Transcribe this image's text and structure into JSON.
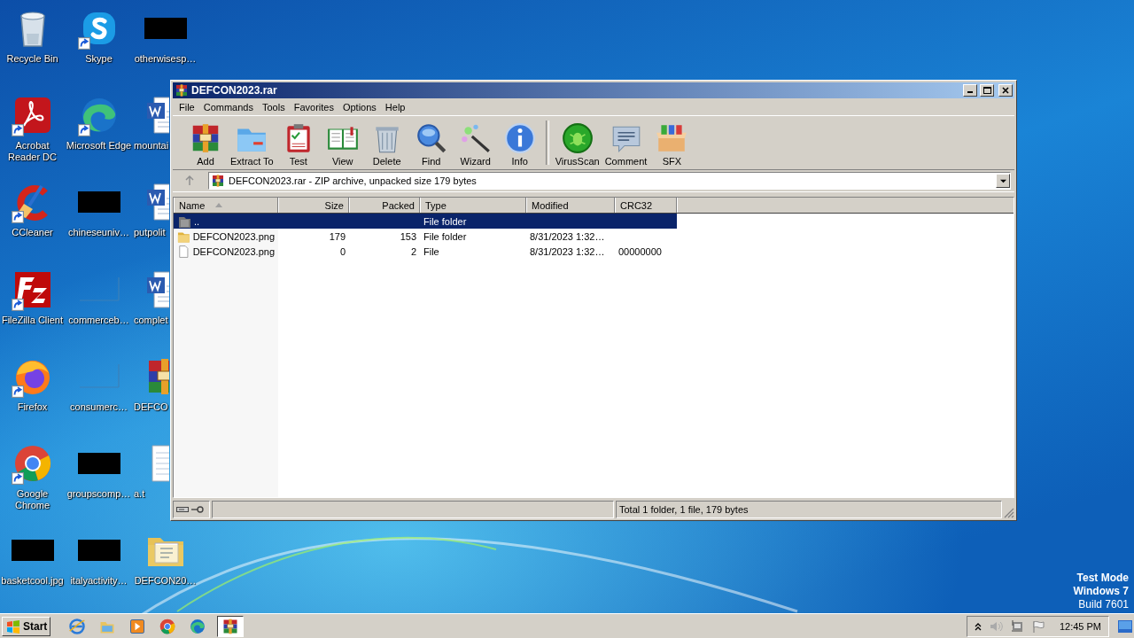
{
  "desktop": {
    "icons": [
      {
        "label": "Recycle Bin",
        "kind": "recycle",
        "shortcut": false
      },
      {
        "label": "Acrobat Reader DC",
        "kind": "pdf",
        "shortcut": true
      },
      {
        "label": "CCleaner",
        "kind": "cleaner",
        "shortcut": true
      },
      {
        "label": "FileZilla Client",
        "kind": "ftp",
        "shortcut": true
      },
      {
        "label": "Firefox",
        "kind": "firefox",
        "shortcut": true
      },
      {
        "label": "Google Chrome",
        "kind": "chrome",
        "shortcut": true
      },
      {
        "label": "basketcool.jpg",
        "kind": "redacted",
        "shortcut": false
      },
      {
        "label": "Skype",
        "kind": "chat",
        "shortcut": true
      },
      {
        "label": "Microsoft Edge",
        "kind": "edge",
        "shortcut": true
      },
      {
        "label": "chineseuniv…",
        "kind": "redacted",
        "shortcut": false
      },
      {
        "label": "commerceb…",
        "kind": "blank",
        "shortcut": false
      },
      {
        "label": "consumerc…",
        "kind": "blank",
        "shortcut": false
      },
      {
        "label": "groupscomp…",
        "kind": "redacted",
        "shortcut": false
      },
      {
        "label": "italyactivity…",
        "kind": "redacted",
        "shortcut": false
      },
      {
        "label": "otherwisesp…",
        "kind": "redacted",
        "shortcut": false
      },
      {
        "label": "mountai",
        "kind": "doc",
        "shortcut": false
      },
      {
        "label": "putpolit",
        "kind": "doc",
        "shortcut": false
      },
      {
        "label": "complet",
        "kind": "doc",
        "shortcut": false
      },
      {
        "label": "DEFCO",
        "kind": "archive",
        "shortcut": false
      },
      {
        "label": "a.t",
        "kind": "text",
        "shortcut": false
      },
      {
        "label": "DEFCON20…",
        "kind": "folder",
        "shortcut": false
      }
    ]
  },
  "window": {
    "title": "DEFCON2023.rar",
    "menu": [
      "File",
      "Commands",
      "Tools",
      "Favorites",
      "Options",
      "Help"
    ],
    "toolbar": {
      "groups": [
        [
          {
            "label": "Add",
            "kind": "add"
          },
          {
            "label": "Extract To",
            "kind": "extract"
          },
          {
            "label": "Test",
            "kind": "test"
          },
          {
            "label": "View",
            "kind": "view"
          },
          {
            "label": "Delete",
            "kind": "delete"
          },
          {
            "label": "Find",
            "kind": "find"
          },
          {
            "label": "Wizard",
            "kind": "wizard"
          },
          {
            "label": "Info",
            "kind": "info"
          }
        ],
        [
          {
            "label": "VirusScan",
            "kind": "scan"
          },
          {
            "label": "Comment",
            "kind": "comment"
          },
          {
            "label": "SFX",
            "kind": "sfx"
          }
        ]
      ]
    },
    "address": {
      "value": "DEFCON2023.rar - ZIP archive, unpacked size 179 bytes"
    },
    "table": {
      "columns": [
        {
          "label": "Name",
          "sorted": true
        },
        {
          "label": "Size",
          "sorted": false
        },
        {
          "label": "Packed",
          "sorted": false
        },
        {
          "label": "Type",
          "sorted": false
        },
        {
          "label": "Modified",
          "sorted": false
        },
        {
          "label": "CRC32",
          "sorted": false
        }
      ],
      "rows": [
        {
          "kind": "up",
          "selected": true,
          "cells": [
            "..",
            "",
            "",
            "File folder",
            "",
            ""
          ]
        },
        {
          "kind": "folder",
          "selected": false,
          "cells": [
            "DEFCON2023.png",
            "179",
            "153",
            "File folder",
            "8/31/2023 1:32…",
            ""
          ]
        },
        {
          "kind": "file",
          "selected": false,
          "cells": [
            "DEFCON2023.png",
            "0",
            "2",
            "File",
            "8/31/2023 1:32…",
            "00000000"
          ]
        }
      ]
    },
    "status_bar": "Total 1 folder, 1 file, 179 bytes"
  },
  "watermark_os": [
    "Test Mode",
    "Windows 7",
    "Build 7601"
  ],
  "taskbar": {
    "start": "Start",
    "items": [
      {
        "kind": "ie",
        "active": false
      },
      {
        "kind": "explorer",
        "active": false
      },
      {
        "kind": "media",
        "active": false
      },
      {
        "kind": "chrome",
        "active": false
      },
      {
        "kind": "edge",
        "active": false
      },
      {
        "kind": "archive",
        "active": true
      }
    ],
    "clock": "12:45 PM"
  }
}
